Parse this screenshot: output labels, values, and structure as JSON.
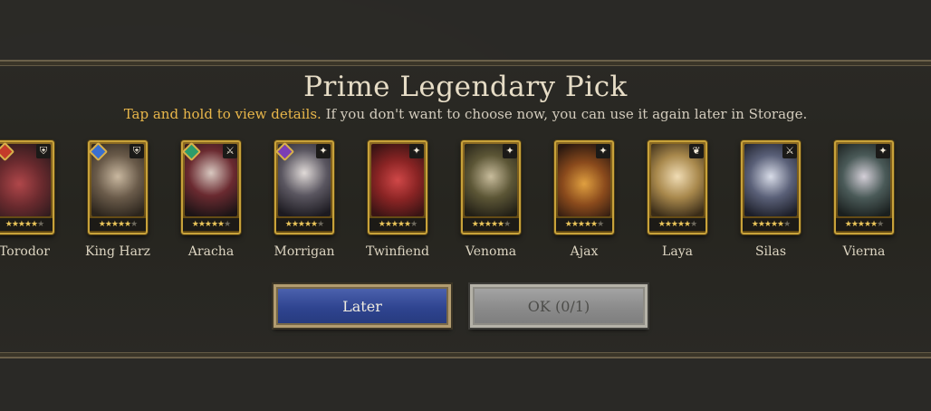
{
  "dialog": {
    "title": "Prime Legendary Pick",
    "subtitle_highlight": "Tap and hold to view details.",
    "subtitle_rest": " If you don't want to choose now, you can use it again later in Storage."
  },
  "heroes": [
    {
      "name": "Torodor",
      "role_icon": "defense-icon",
      "affinity_icon": "force-affinity-icon",
      "stars": 5
    },
    {
      "name": "King Harz",
      "role_icon": "defense-icon",
      "affinity_icon": "magic-affinity-icon",
      "stars": 5
    },
    {
      "name": "Aracha",
      "role_icon": "attack-icon",
      "affinity_icon": "spirit-affinity-icon",
      "stars": 5
    },
    {
      "name": "Morrigan",
      "role_icon": "support-icon",
      "affinity_icon": "void-affinity-icon",
      "stars": 5
    },
    {
      "name": "Twinfiend",
      "role_icon": "support-icon",
      "affinity_icon": "",
      "stars": 5
    },
    {
      "name": "Venoma",
      "role_icon": "support-icon",
      "affinity_icon": "",
      "stars": 5
    },
    {
      "name": "Ajax",
      "role_icon": "support-icon",
      "affinity_icon": "",
      "stars": 5
    },
    {
      "name": "Laya",
      "role_icon": "hp-icon",
      "affinity_icon": "",
      "stars": 5
    },
    {
      "name": "Silas",
      "role_icon": "attack-icon",
      "affinity_icon": "",
      "stars": 5
    },
    {
      "name": "Vierna",
      "role_icon": "support-icon",
      "affinity_icon": "",
      "stars": 5
    }
  ],
  "buttons": {
    "later_label": "Later",
    "ok_label": "OK (0/1)"
  },
  "colors": {
    "highlight": "#e9b74a",
    "card_border": "#c8a23a",
    "later_button": "#3a51a0",
    "ok_button_disabled": "#8f8f8f"
  }
}
